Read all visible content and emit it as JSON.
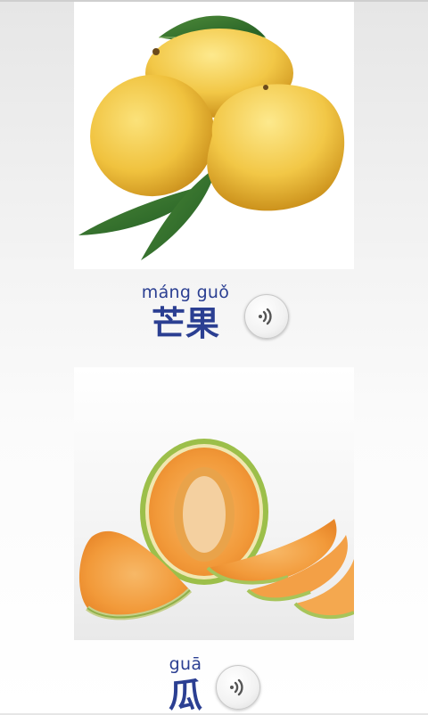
{
  "items": [
    {
      "pinyin": "máng guǒ",
      "hanzi": "芒果",
      "image": "mango-photo",
      "audio_icon": "speaker-icon"
    },
    {
      "pinyin": "guā",
      "hanzi": "瓜",
      "image": "melon-photo",
      "audio_icon": "speaker-icon"
    }
  ],
  "colors": {
    "text": "#2b3f92",
    "background": "#f3f3f3"
  }
}
